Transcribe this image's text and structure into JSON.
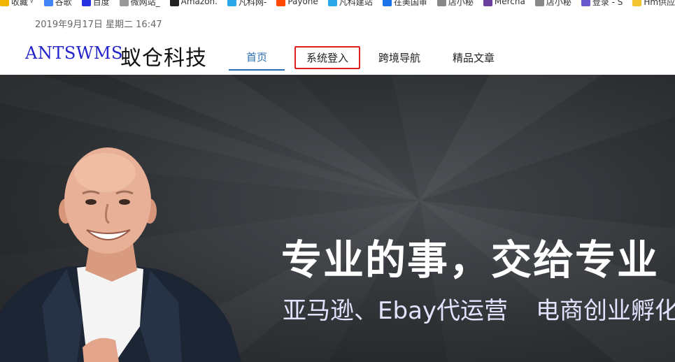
{
  "bookmarks": [
    {
      "label": "收藏",
      "icon": "star-icon",
      "caret": "∨",
      "color": "#f2b400"
    },
    {
      "label": "谷歌",
      "icon": "google-icon",
      "color": "#4285f4"
    },
    {
      "label": "百度",
      "icon": "baidu-icon",
      "color": "#2932e1"
    },
    {
      "label": "微网站_",
      "icon": "page-icon",
      "color": "#999999"
    },
    {
      "label": "Amazon.",
      "icon": "amazon-icon",
      "color": "#222222"
    },
    {
      "label": "凡科网-",
      "icon": "fanke-icon",
      "color": "#2aa7e8"
    },
    {
      "label": "Payone",
      "icon": "payoneer-icon",
      "color": "#ff4800"
    },
    {
      "label": "凡科建站",
      "icon": "fanke-icon",
      "color": "#2aa7e8"
    },
    {
      "label": "在美国审",
      "icon": "bookmark-icon",
      "color": "#1a73e8"
    },
    {
      "label": "店小秘",
      "icon": "dianxiaomi-icon",
      "color": "#888888"
    },
    {
      "label": "Mercha",
      "icon": "merchant-icon",
      "color": "#6b3fa0"
    },
    {
      "label": "店小秘",
      "icon": "dianxiaomi-icon",
      "color": "#888888"
    },
    {
      "label": "登录 - S",
      "icon": "login-icon",
      "color": "#6a5acd"
    },
    {
      "label": "Hm供应",
      "icon": "folder-icon",
      "color": "#f4c430"
    }
  ],
  "date_line": "2019年9月17日 星期二 16:47",
  "logo": {
    "en": "ANTSWMS",
    "cn": "蚁仓科技",
    "en_color": "#2323cc"
  },
  "nav": {
    "home": "首页",
    "login": "系统登入",
    "cross_border": "跨境导航",
    "articles": "精品文章",
    "active_color": "#2a6fb5",
    "highlight_color": "#e02020"
  },
  "hero": {
    "title": "专业的事，交给专业",
    "sub_left": "亚马逊、Ebay代运营",
    "sub_right": "电商创业孵化"
  }
}
